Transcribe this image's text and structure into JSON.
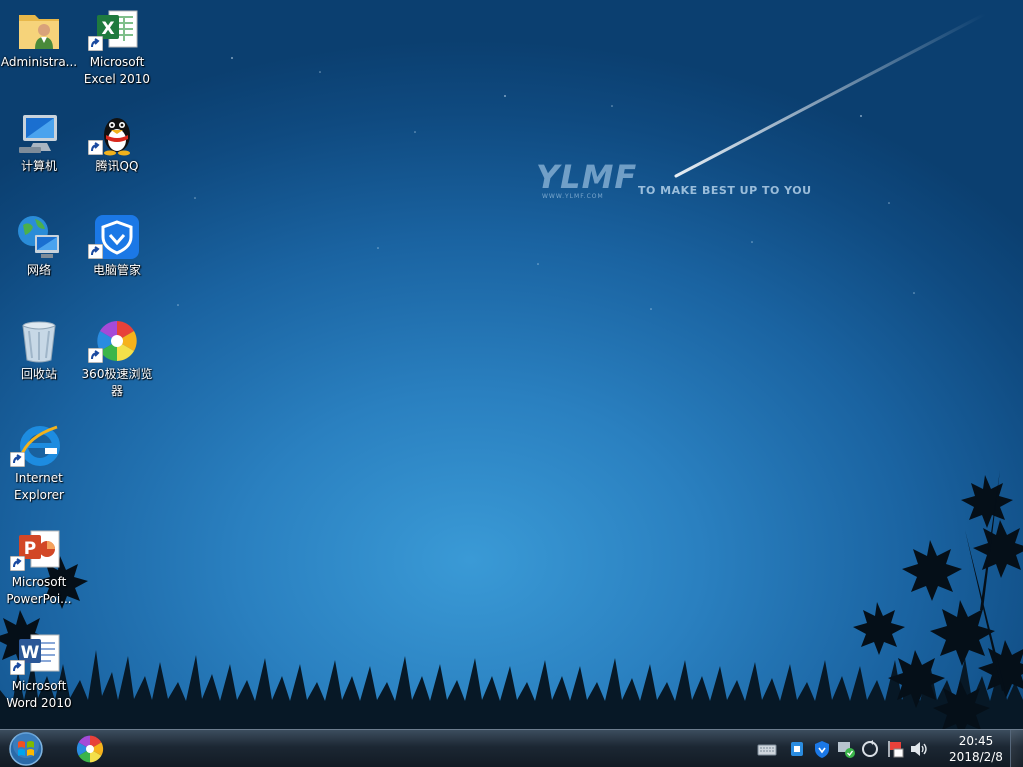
{
  "wallpaper": {
    "logo_text": "YLMF",
    "logo_url": "WWW.YLMF.COM",
    "slogan": "TO MAKE BEST UP TO YOU"
  },
  "desktop_icons": [
    {
      "label": "Administra...",
      "icon": "user-folder-icon",
      "shortcut": false
    },
    {
      "label": "Microsoft\nExcel 2010",
      "icon": "excel-icon",
      "shortcut": true
    },
    {
      "label": "计算机",
      "icon": "computer-icon",
      "shortcut": false
    },
    {
      "label": "腾讯QQ",
      "icon": "qq-penguin-icon",
      "shortcut": true
    },
    {
      "label": "网络",
      "icon": "network-globe-icon",
      "shortcut": false
    },
    {
      "label": "电脑管家",
      "icon": "tencent-pc-manager-icon",
      "shortcut": true
    },
    {
      "label": "回收站",
      "icon": "recycle-bin-icon",
      "shortcut": false
    },
    {
      "label": "360极速浏览\n器",
      "icon": "360-browser-icon",
      "shortcut": true
    },
    {
      "label": "Internet\nExplorer",
      "icon": "internet-explorer-icon",
      "shortcut": true
    },
    {
      "label": "Microsoft\nPowerPoi...",
      "icon": "powerpoint-icon",
      "shortcut": true
    },
    {
      "label": "Microsoft\nWord 2010",
      "icon": "word-icon",
      "shortcut": true
    }
  ],
  "taskbar": {
    "start_icon": "windows-orb-icon",
    "pinned": [
      {
        "icon": "360-browser-icon"
      }
    ],
    "tray_icons": [
      "keyboard-icon",
      "tray-security-icon",
      "shield-icon",
      "network-check-icon",
      "update-icon",
      "flag-icon",
      "volume-icon"
    ],
    "clock": {
      "time": "20:45",
      "date": "2018/2/8"
    }
  }
}
